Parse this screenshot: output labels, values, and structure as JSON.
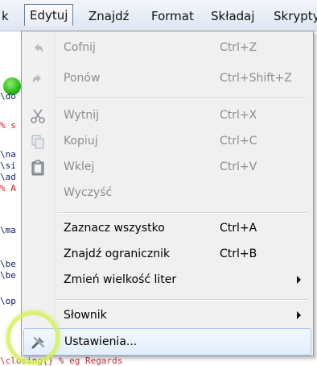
{
  "menubar": {
    "items": [
      {
        "label": "k"
      },
      {
        "label": "Edytuj"
      },
      {
        "label": "Znajdź"
      },
      {
        "label": "Format"
      },
      {
        "label": "Składaj"
      },
      {
        "label": "Skrypty"
      }
    ]
  },
  "editor": {
    "lines": [
      "\\do",
      "% s",
      "\\na",
      "\\si",
      "\\ad",
      "% A",
      "\\ma",
      "\\be",
      "\\be",
      "\\op"
    ],
    "bottom_line": "\\closing{} % eg Regards"
  },
  "menu": {
    "items": [
      {
        "label": "Cofnij",
        "shortcut": "Ctrl+Z",
        "icon": "undo-icon",
        "disabled": true
      },
      {
        "label": "Ponów",
        "shortcut": "Ctrl+Shift+Z",
        "icon": "redo-icon",
        "disabled": true
      },
      {
        "label": "Wytnij",
        "shortcut": "Ctrl+X",
        "icon": "scissors-icon",
        "disabled": true
      },
      {
        "label": "Kopiuj",
        "shortcut": "Ctrl+C",
        "icon": "copy-icon",
        "disabled": true
      },
      {
        "label": "Wklej",
        "shortcut": "Ctrl+V",
        "icon": "clipboard-icon",
        "disabled": true
      },
      {
        "label": "Wyczyść",
        "shortcut": "",
        "disabled": true
      },
      {
        "label": "Zaznacz wszystko",
        "shortcut": "Ctrl+A",
        "disabled": false
      },
      {
        "label": "Znajdź ogranicznik",
        "shortcut": "Ctrl+B",
        "disabled": false
      },
      {
        "label": "Zmień wielkość liter",
        "shortcut": "",
        "submenu": true,
        "disabled": false
      },
      {
        "label": "Słownik",
        "shortcut": "",
        "submenu": true,
        "disabled": false
      },
      {
        "label": "Ustawienia...",
        "shortcut": "",
        "icon": "tools-icon",
        "disabled": false,
        "highlighted": true
      }
    ]
  },
  "colors": {
    "accent_green": "#24b81a",
    "highlight_border": "#a8c7ef",
    "code_red": "#d61818"
  }
}
